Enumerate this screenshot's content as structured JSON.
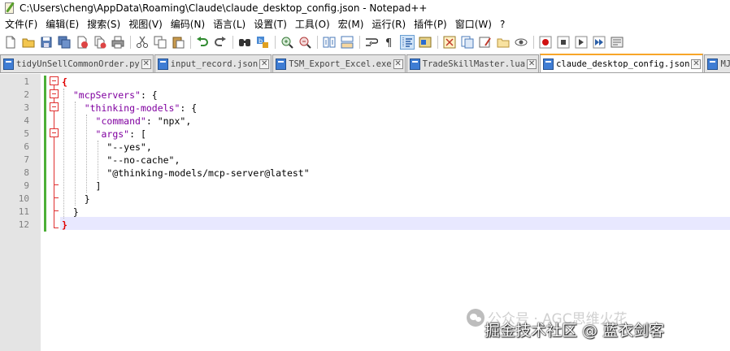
{
  "window": {
    "title": "C:\\Users\\cheng\\AppData\\Roaming\\Claude\\claude_desktop_config.json - Notepad++",
    "app_icon": "notepadpp-icon"
  },
  "menu": [
    "文件(F)",
    "编辑(E)",
    "搜索(S)",
    "视图(V)",
    "编码(N)",
    "语言(L)",
    "设置(T)",
    "工具(O)",
    "宏(M)",
    "运行(R)",
    "插件(P)",
    "窗口(W)",
    "?"
  ],
  "toolbar": {
    "icons": [
      "new-file-icon",
      "open-file-icon",
      "save-icon",
      "save-all-icon",
      "close-icon",
      "close-all-icon",
      "print-icon",
      "cut-icon",
      "copy-icon",
      "paste-icon",
      "undo-icon",
      "redo-icon",
      "find-icon",
      "replace-icon",
      "zoom-in-icon",
      "zoom-out-icon",
      "sync-vertical-icon",
      "sync-horizontal-icon",
      "word-wrap-icon",
      "show-all-chars-icon",
      "indent-guide-icon",
      "udl-icon",
      "doc-map-icon",
      "function-list-icon",
      "folder-workspace-icon",
      "monitor-icon",
      "record-macro-icon",
      "stop-macro-icon",
      "play-macro-icon",
      "run-macro-multiple-icon",
      "save-macro-icon"
    ],
    "active_icon": "indent-guide-icon"
  },
  "tabs": [
    {
      "name": "tidyUnSellCommonOrder.py",
      "active": false
    },
    {
      "name": "input_record.json",
      "active": false
    },
    {
      "name": "TSM_Export_Excel.exe",
      "active": false
    },
    {
      "name": "TradeSkillMaster.lua",
      "active": false
    },
    {
      "name": "claude_desktop_config.json",
      "active": true
    },
    {
      "name": "MJ提示",
      "active": false
    }
  ],
  "editor": {
    "line_numbers": [
      "1",
      "2",
      "3",
      "4",
      "5",
      "6",
      "7",
      "8",
      "9",
      "10",
      "11",
      "12"
    ],
    "lines": [
      [
        {
          "t": "{",
          "c": "brace"
        }
      ],
      [
        {
          "t": "  ",
          "c": "op"
        },
        {
          "t": "\"mcpServers\"",
          "c": "key"
        },
        {
          "t": ": {",
          "c": "op"
        }
      ],
      [
        {
          "t": "    ",
          "c": "op"
        },
        {
          "t": "\"thinking-models\"",
          "c": "key"
        },
        {
          "t": ": {",
          "c": "op"
        }
      ],
      [
        {
          "t": "      ",
          "c": "op"
        },
        {
          "t": "\"command\"",
          "c": "key"
        },
        {
          "t": ": \"npx\",",
          "c": "str"
        }
      ],
      [
        {
          "t": "      ",
          "c": "op"
        },
        {
          "t": "\"args\"",
          "c": "key"
        },
        {
          "t": ": [",
          "c": "op"
        }
      ],
      [
        {
          "t": "        \"--yes\",",
          "c": "str"
        }
      ],
      [
        {
          "t": "        \"--no-cache\",",
          "c": "str"
        }
      ],
      [
        {
          "t": "        \"@thinking-models/mcp-server@latest\"",
          "c": "str"
        }
      ],
      [
        {
          "t": "      ]",
          "c": "op"
        }
      ],
      [
        {
          "t": "    }",
          "c": "op"
        }
      ],
      [
        {
          "t": "  }",
          "c": "op"
        }
      ],
      [
        {
          "t": "}",
          "c": "brace"
        }
      ]
    ],
    "current_line": 12
  },
  "watermark": {
    "faint_text": "公众号 · AGC思维火花",
    "strong_text": "掘金技术社区 @ 蓝衣剑客"
  }
}
